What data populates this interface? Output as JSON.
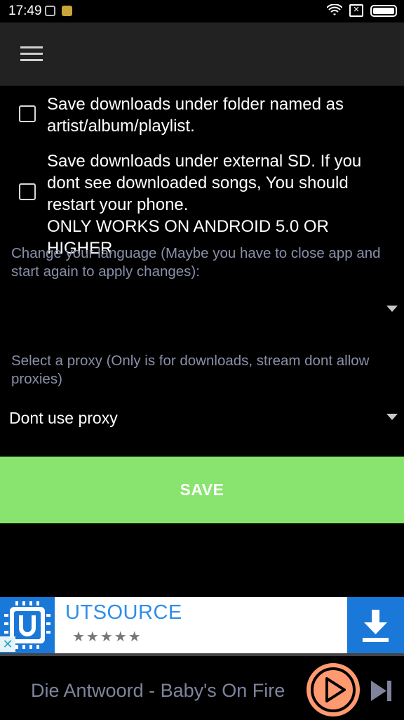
{
  "status_bar": {
    "time": "17:49"
  },
  "settings": {
    "folder_option": {
      "label": "Save downloads under folder named as\nartist/album/playlist.",
      "checked": false
    },
    "sd_option": {
      "label": "Save downloads under external SD. If you\ndont see downloaded songs, You should\nrestart your phone.\nONLY WORKS ON ANDROID 5.0 OR HIGHER",
      "checked": false
    },
    "language_label": "Change your language (Maybe you have to close app and start again to apply changes):",
    "language_value": "",
    "proxy_label": "Select a proxy (Only is for downloads, stream dont allow proxies)",
    "proxy_value": "Dont use proxy",
    "save_label": "SAVE"
  },
  "ad": {
    "title": "UTSOURCE",
    "stars": "★★★★★",
    "close": "✕"
  },
  "player": {
    "track": "Die Antwoord - Baby's On Fire"
  },
  "colors": {
    "save": "#88e46f",
    "ad_blue": "#1a78d8",
    "play": "#ff9a70",
    "label": "#8a8fa8"
  }
}
